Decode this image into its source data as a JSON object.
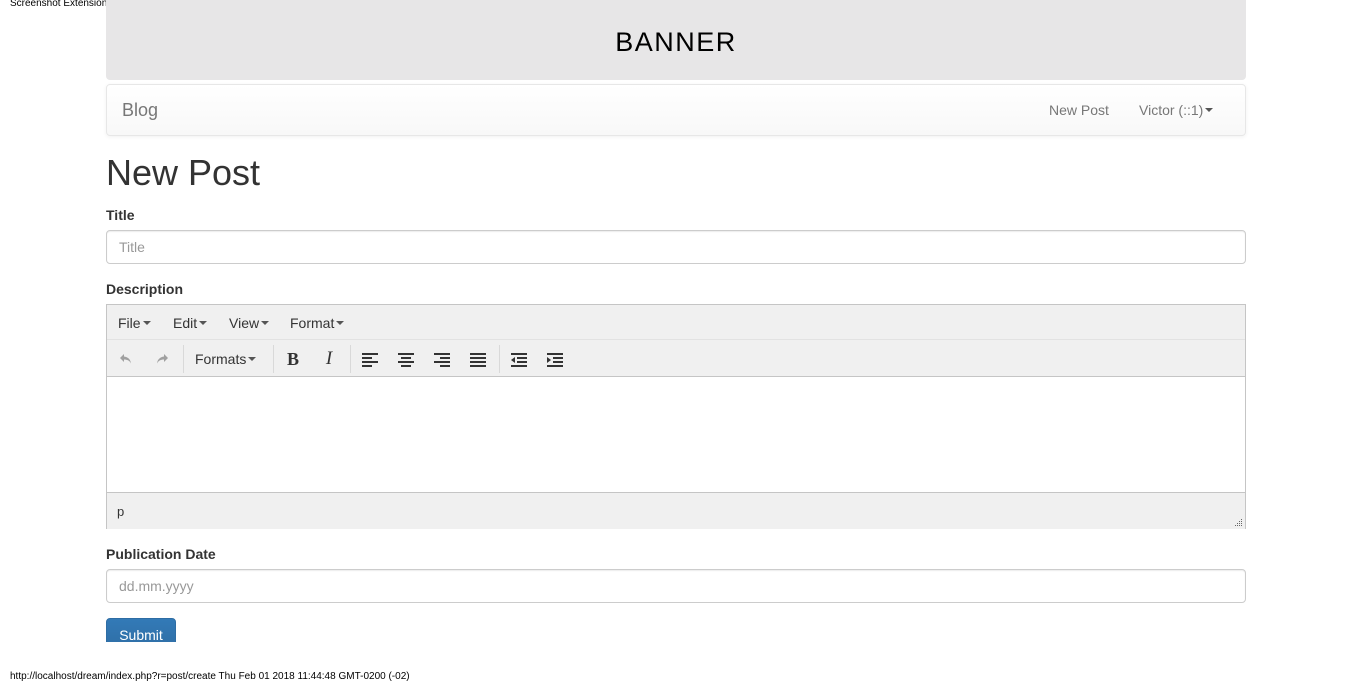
{
  "extension_label": "Screenshot Extension",
  "banner": {
    "text": "BANNER"
  },
  "navbar": {
    "brand": "Blog",
    "new_post": "New Post",
    "user": "Victor (::1)"
  },
  "page": {
    "title": "New Post"
  },
  "form": {
    "title_label": "Title",
    "title_placeholder": "Title",
    "description_label": "Description",
    "pubdate_label": "Publication Date",
    "pubdate_placeholder": "dd.mm.yyyy",
    "submit_label": "Submit"
  },
  "editor": {
    "menus": [
      "File",
      "Edit",
      "View",
      "Format"
    ],
    "formats_label": "Formats",
    "toolbar_icons": [
      "undo-icon",
      "redo-icon",
      "bold-icon",
      "italic-icon",
      "align-left-icon",
      "align-center-icon",
      "align-right-icon",
      "justify-icon",
      "outdent-icon",
      "indent-icon"
    ],
    "path": "p"
  },
  "footer": {
    "text": "http://localhost/dream/index.php?r=post/create Thu Feb 01 2018 11:44:48 GMT-0200 (-02)"
  },
  "colors": {
    "banner_bg": "#e7e6e7",
    "primary": "#337ab7",
    "toolbar_bg": "#f0f0f0"
  }
}
